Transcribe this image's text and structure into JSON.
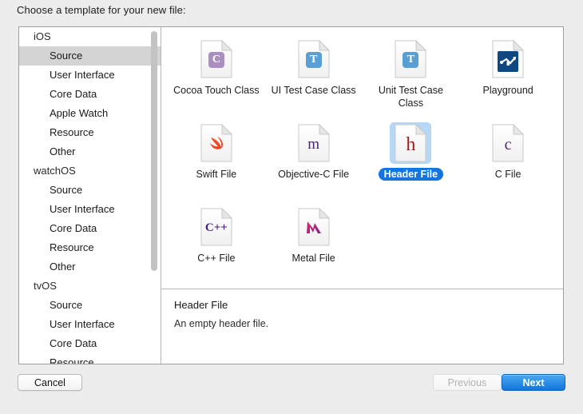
{
  "dialog": {
    "title": "Choose a template for your new file:"
  },
  "sidebar": {
    "scrollbar": "vertical-scrollbar",
    "rows": [
      {
        "label": "iOS",
        "type": "group",
        "selected": false
      },
      {
        "label": "Source",
        "type": "item",
        "selected": true
      },
      {
        "label": "User Interface",
        "type": "item",
        "selected": false
      },
      {
        "label": "Core Data",
        "type": "item",
        "selected": false
      },
      {
        "label": "Apple Watch",
        "type": "item",
        "selected": false
      },
      {
        "label": "Resource",
        "type": "item",
        "selected": false
      },
      {
        "label": "Other",
        "type": "item",
        "selected": false
      },
      {
        "label": "watchOS",
        "type": "group",
        "selected": false
      },
      {
        "label": "Source",
        "type": "item",
        "selected": false
      },
      {
        "label": "User Interface",
        "type": "item",
        "selected": false
      },
      {
        "label": "Core Data",
        "type": "item",
        "selected": false
      },
      {
        "label": "Resource",
        "type": "item",
        "selected": false
      },
      {
        "label": "Other",
        "type": "item",
        "selected": false
      },
      {
        "label": "tvOS",
        "type": "group",
        "selected": false
      },
      {
        "label": "Source",
        "type": "item",
        "selected": false
      },
      {
        "label": "User Interface",
        "type": "item",
        "selected": false
      },
      {
        "label": "Core Data",
        "type": "item",
        "selected": false
      },
      {
        "label": "Resource",
        "type": "item",
        "selected": false
      }
    ]
  },
  "templates": [
    {
      "label": "Cocoa Touch Class",
      "icon": "cocoa-touch-class-icon",
      "selected": false
    },
    {
      "label": "UI Test Case Class",
      "icon": "ui-test-case-class-icon",
      "selected": false
    },
    {
      "label": "Unit Test Case Class",
      "icon": "unit-test-case-class-icon",
      "selected": false
    },
    {
      "label": "Playground",
      "icon": "playground-icon",
      "selected": false
    },
    {
      "label": "Swift File",
      "icon": "swift-file-icon",
      "selected": false
    },
    {
      "label": "Objective-C File",
      "icon": "objective-c-file-icon",
      "selected": false
    },
    {
      "label": "Header File",
      "icon": "header-file-icon",
      "selected": true
    },
    {
      "label": "C File",
      "icon": "c-file-icon",
      "selected": false
    },
    {
      "label": "C++ File",
      "icon": "cpp-file-icon",
      "selected": false
    },
    {
      "label": "Metal File",
      "icon": "metal-file-icon",
      "selected": false
    }
  ],
  "description": {
    "title": "Header File",
    "body": "An empty header file."
  },
  "footer": {
    "cancel_label": "Cancel",
    "previous_label": "Previous",
    "next_label": "Next"
  },
  "colors": {
    "accent_blue": "#1175dd",
    "selection_blue": "#1575e0",
    "icon_highlight": "#b6d7f5",
    "sidebar_selection": "#d4d4d4",
    "window_bg": "#ececec",
    "cocoa_touch_badge": "#a98fc0",
    "test_badge": "#5a9fd4",
    "playground_bg": "#0f4880",
    "swift_orange": "#f05a28",
    "objc_purple": "#4a1f7a",
    "header_red": "#a81a1a",
    "c_purple": "#4a1f7a",
    "metal_pink": "#e8216a"
  }
}
